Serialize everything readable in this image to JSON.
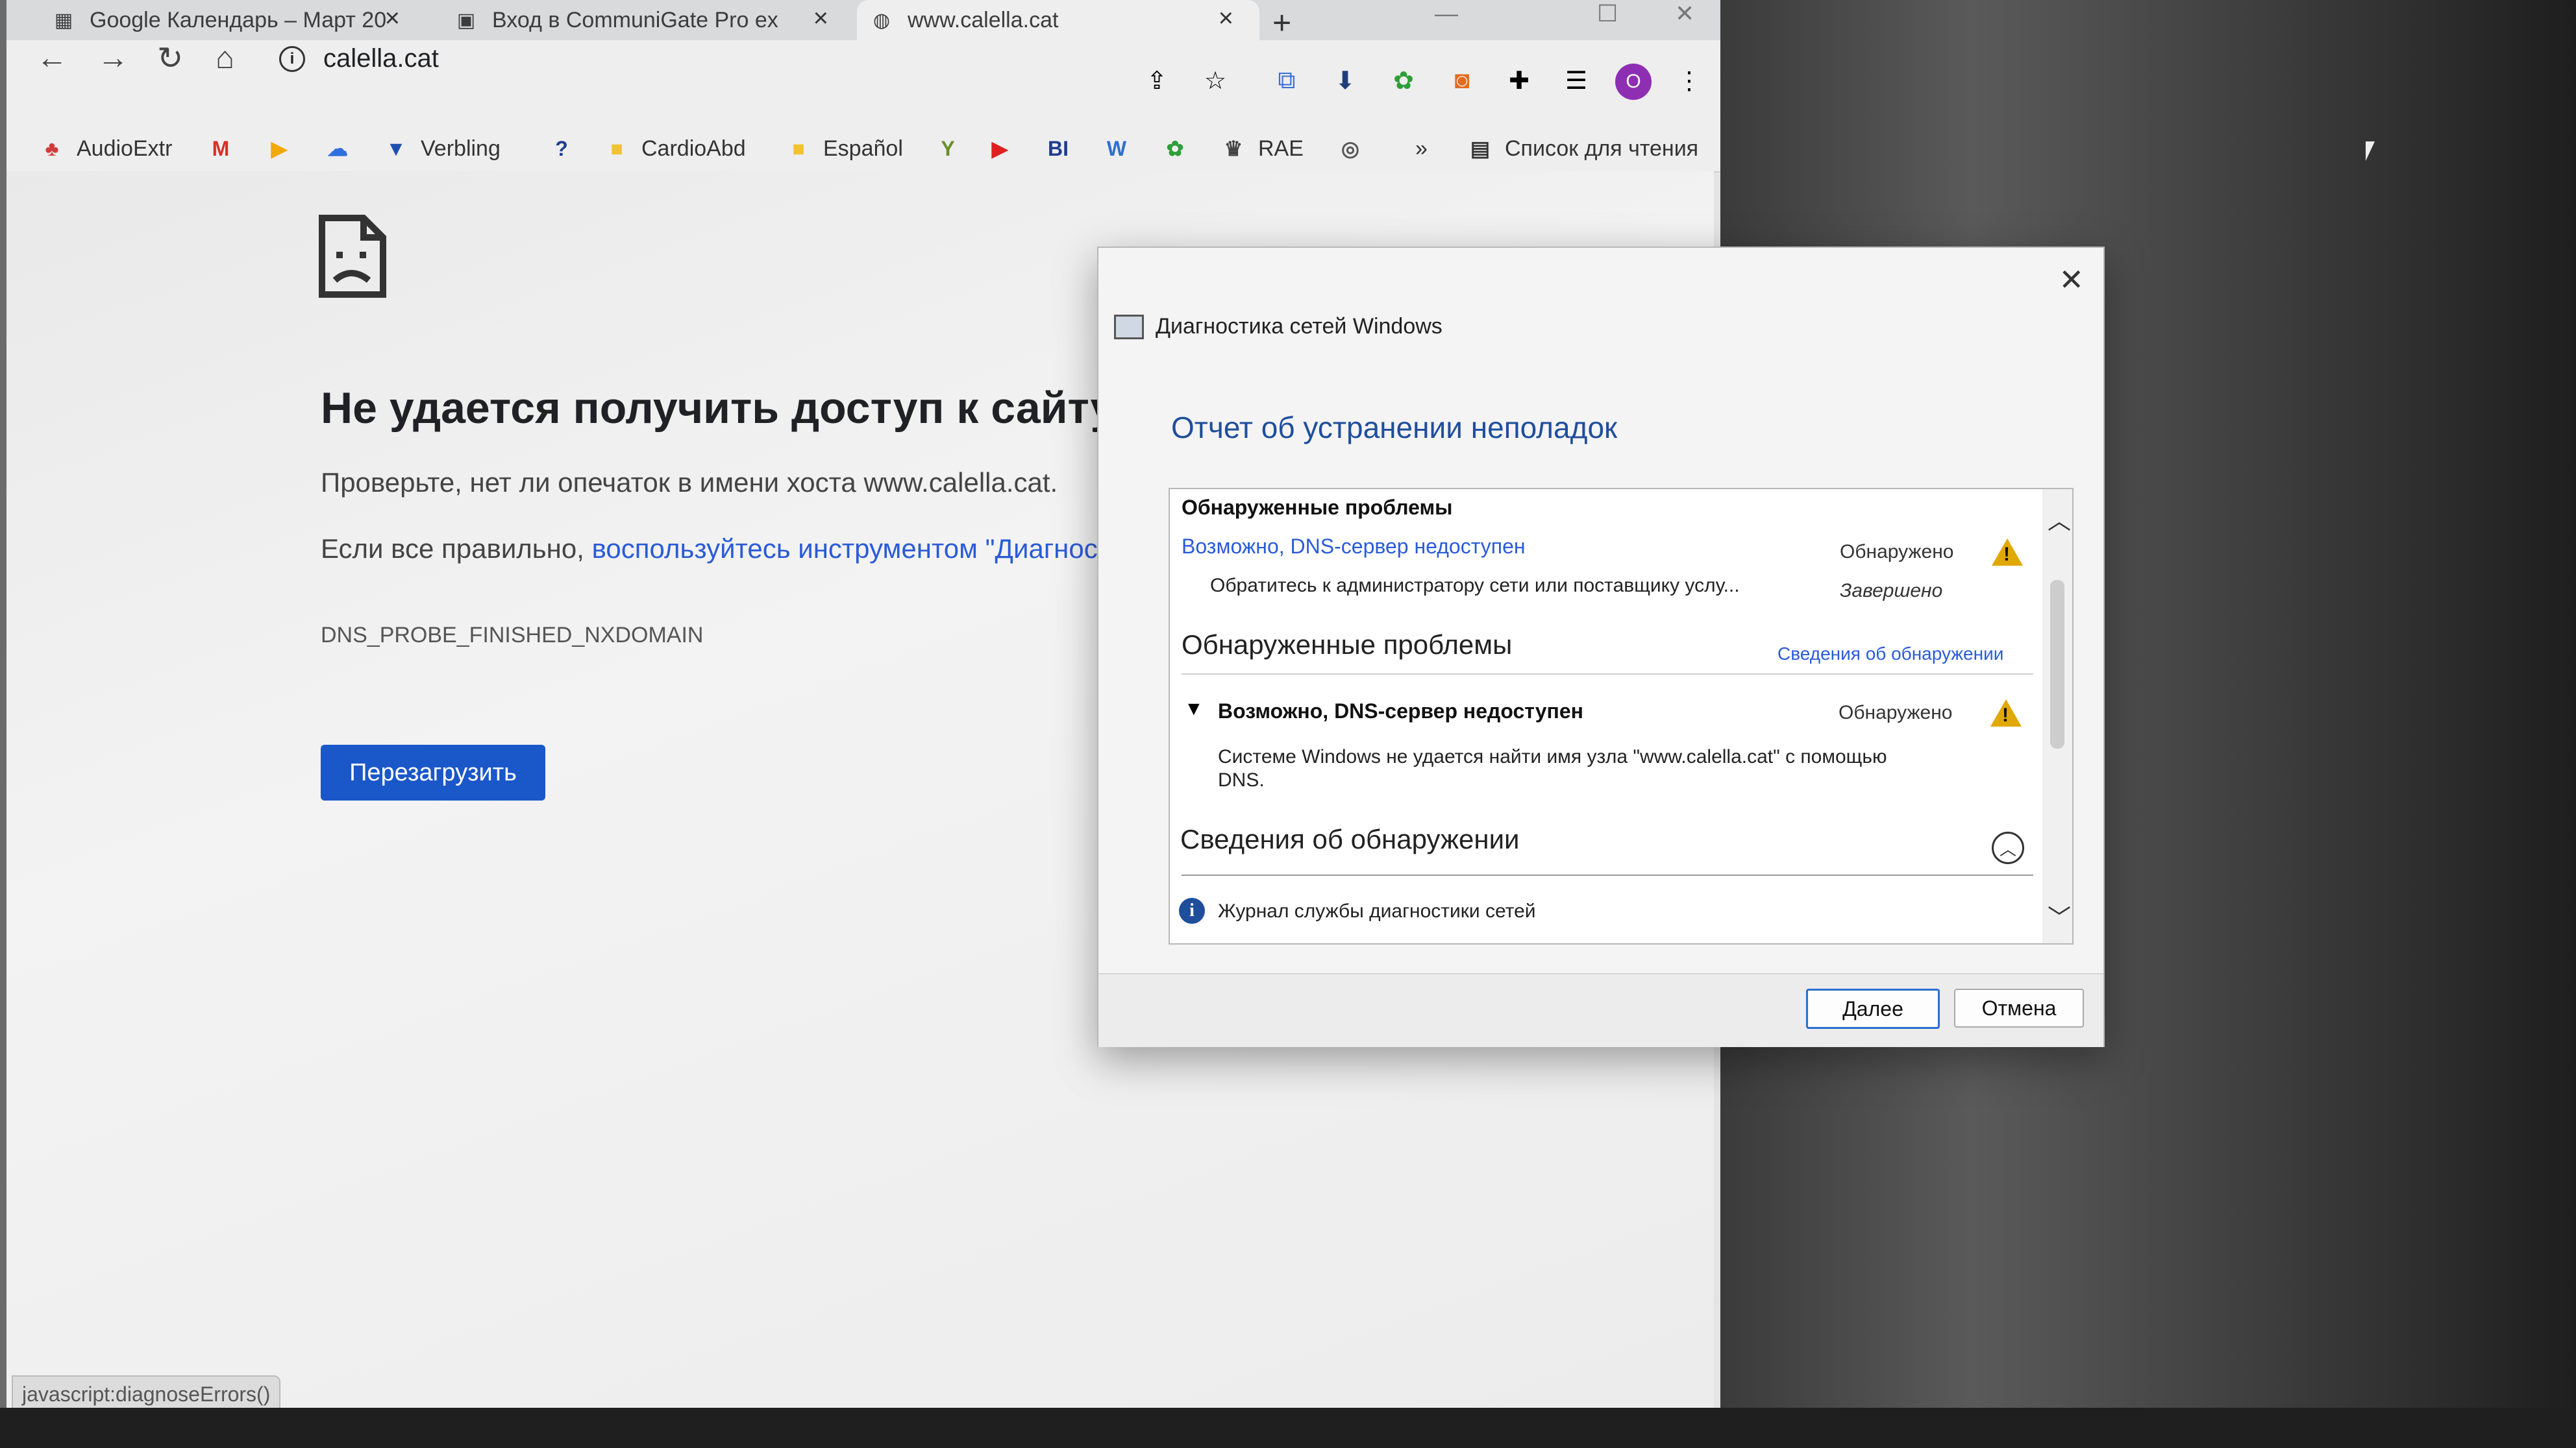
{
  "tabs": [
    {
      "title": "Google Календарь – Март 20",
      "icon": "calendar-icon"
    },
    {
      "title": "Вход в CommuniGate Pro ex",
      "icon": "communigate-icon"
    },
    {
      "title": "www.calella.cat",
      "icon": "globe-icon",
      "active": true
    }
  ],
  "toolbar": {
    "url": "calella.cat"
  },
  "bookmarks": [
    {
      "label": "AudioExtr",
      "icon": "audioextr-icon"
    },
    {
      "label": "",
      "icon": "gmail-icon"
    },
    {
      "label": "",
      "icon": "play-icon"
    },
    {
      "label": "",
      "icon": "cloud-icon"
    },
    {
      "label": "Verbling",
      "icon": "verbling-icon"
    },
    {
      "label": "",
      "icon": "help-icon"
    },
    {
      "label": "CardioAbd",
      "icon": "folder-icon"
    },
    {
      "label": "Español",
      "icon": "folder-icon"
    },
    {
      "label": "",
      "icon": "y-icon"
    },
    {
      "label": "",
      "icon": "youtube-icon"
    },
    {
      "label": "",
      "icon": "bi-icon"
    },
    {
      "label": "",
      "icon": "wp-icon"
    },
    {
      "label": "",
      "icon": "evernote-icon"
    },
    {
      "label": "RAE",
      "icon": "rae-icon"
    },
    {
      "label": "",
      "icon": "sync-icon"
    }
  ],
  "bookmarks_more": "»",
  "reading_list": "Список для чтения",
  "error_page": {
    "title": "Не удается получить доступ к сайту",
    "line1": "Проверьте, нет ли опечаток в имени хоста www.calella.cat.",
    "line2_prefix": "Если все правильно, ",
    "line2_link": "воспользуйтесь инструментом \"Диагнос",
    "code": "DNS_PROBE_FINISHED_NXDOMAIN",
    "reload_label": "Перезагрузить"
  },
  "statusbar": "javascript:diagnoseErrors()",
  "dialog": {
    "window_title": "Диагностика сетей Windows",
    "heading": "Отчет об устранении неполадок",
    "section1_title": "Обнаруженные проблемы",
    "problem_link": "Возможно, DNS-сервер недоступен",
    "problem_status": "Обнаружено",
    "problem_action": "Обратитесь к администратору сети или поставщику услу...",
    "problem_action_status": "Завершено",
    "section2_title": "Обнаруженные проблемы",
    "section2_link": "Сведения об обнаружении",
    "detail_title": "Возможно, DNS-сервер недоступен",
    "detail_status": "Обнаружено",
    "detail_desc_line1": "Системе Windows не удается найти имя узла \"www.calella.cat\" с помощью",
    "detail_desc_line2": "DNS.",
    "section3_title": "Сведения об обнаружении",
    "log_label": "Журнал службы диагностики сетей",
    "next_label": "Далее",
    "cancel_label": "Отмена"
  },
  "colors": {
    "link": "#2a5bd7",
    "heading": "#1f4e9c",
    "reload_button": "#1a57c9",
    "warning": "#e0a800"
  }
}
